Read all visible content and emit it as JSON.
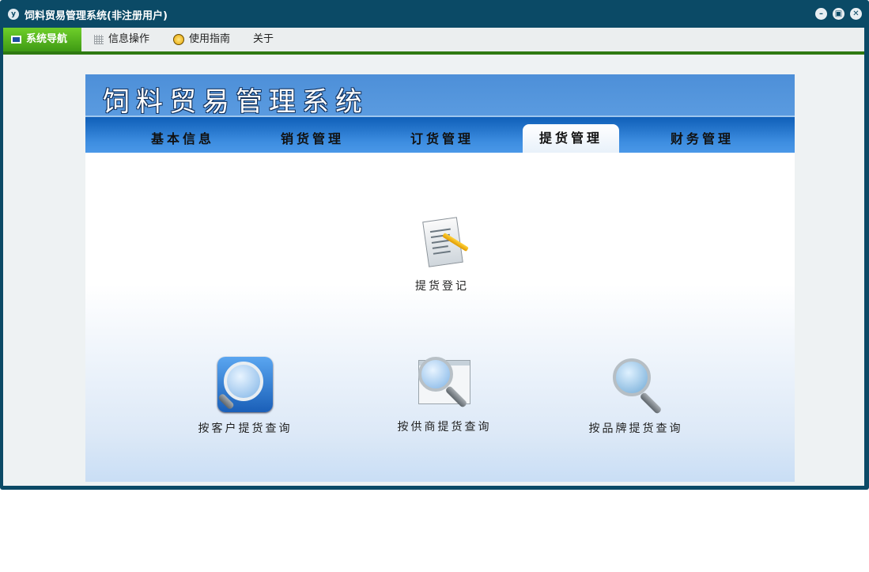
{
  "window": {
    "icon_text": "y",
    "title": "饲料贸易管理系统(非注册用户)"
  },
  "menu": {
    "items": [
      {
        "label": "系统导航",
        "icon": "monitor-icon"
      },
      {
        "label": "信息操作",
        "icon": "grid-icon"
      },
      {
        "label": "使用指南",
        "icon": "guide-icon"
      },
      {
        "label": "关于"
      }
    ]
  },
  "banner": {
    "title": "饲料贸易管理系统"
  },
  "tabs": [
    {
      "label": "基本信息"
    },
    {
      "label": "销货管理"
    },
    {
      "label": "订货管理"
    },
    {
      "label": "提货管理",
      "active": true
    },
    {
      "label": "财务管理"
    }
  ],
  "functions": [
    {
      "label": "提货登记",
      "icon": "notepad-pencil-icon"
    },
    {
      "label": "按客户提货查询",
      "icon": "blue-magnifier-icon"
    },
    {
      "label": "按供商提货查询",
      "icon": "window-magnifier-icon"
    },
    {
      "label": "按品牌提货查询",
      "icon": "magnifier-icon"
    }
  ],
  "colors": {
    "frame": "#0b4a66",
    "menu_active": "#4aa81b",
    "banner": "#5a9be0",
    "tabbar": "#1f6fc6"
  }
}
